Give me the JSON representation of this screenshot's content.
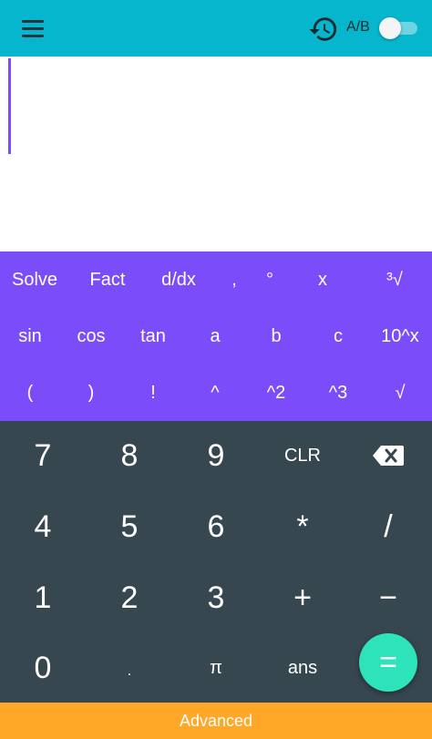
{
  "header": {
    "menu_icon": "hamburger-menu-icon",
    "history_icon": "history-icon",
    "ab_label": "A/B",
    "ab_toggle_on": false
  },
  "display": {
    "expression": ""
  },
  "advanced_keys": {
    "row1": [
      "Solve",
      "Fact",
      "d/dx",
      ",",
      "°",
      "x",
      "³√"
    ],
    "row2": [
      "sin",
      "cos",
      "tan",
      "a",
      "b",
      "c",
      "10^x"
    ],
    "row3": [
      "(",
      ")",
      "!",
      "^",
      "^2",
      "^3",
      "√"
    ]
  },
  "main_keys": {
    "row1": [
      "7",
      "8",
      "9",
      "CLR"
    ],
    "row2": [
      "4",
      "5",
      "6",
      "*",
      "/"
    ],
    "row3": [
      "1",
      "2",
      "3",
      "+",
      "−"
    ],
    "row4": [
      "0",
      ".",
      "π",
      "ans"
    ],
    "backspace_icon": "backspace-icon"
  },
  "equals_label": "=",
  "footer": {
    "advanced_label": "Advanced"
  },
  "colors": {
    "topbar": "#06b6cc",
    "advanced_pad": "#7b4dfa",
    "main_pad": "#37474f",
    "equals_button": "#2ee3b9",
    "advanced_bar": "#ffa726"
  }
}
